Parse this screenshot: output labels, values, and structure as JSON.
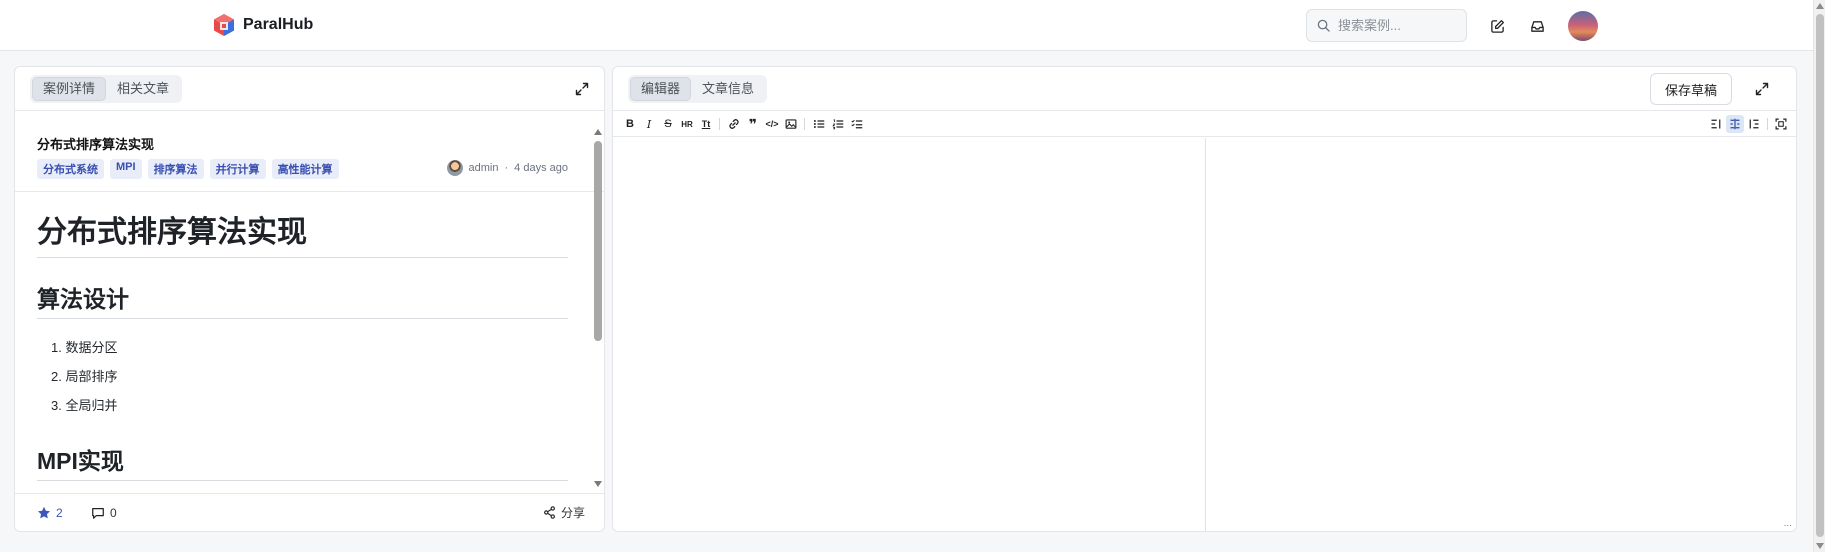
{
  "header": {
    "app_name": "ParalHub",
    "search_placeholder": "搜索案例...",
    "colors": {
      "brand_red": "#e84a4a",
      "brand_blue": "#3b6fe0"
    }
  },
  "left_panel": {
    "tabs": [
      {
        "label": "案例详情",
        "active": true
      },
      {
        "label": "相关文章",
        "active": false
      }
    ],
    "article": {
      "title": "分布式排序算法实现",
      "tags": [
        "分布式系统",
        "MPI",
        "排序算法",
        "并行计算",
        "高性能计算"
      ],
      "author": "admin",
      "separator": "·",
      "time": "4 days ago",
      "h1": "分布式排序算法实现",
      "section1": {
        "heading": "算法设计",
        "items": [
          "1. 数据分区",
          "2. 局部排序",
          "3. 全局归并"
        ]
      },
      "section2": {
        "heading": "MPI实现"
      }
    },
    "footer": {
      "stars": "2",
      "comments": "0",
      "share_label": "分享"
    }
  },
  "right_panel": {
    "tabs": [
      {
        "label": "编辑器",
        "active": true
      },
      {
        "label": "文章信息",
        "active": false
      }
    ],
    "save_label": "保存草稿",
    "toolbar": {
      "bold": "B",
      "italic": "I",
      "strike": "S",
      "hr": "HR",
      "title": "Tt",
      "quote": "❞",
      "code": "</>"
    },
    "resize_hint": "..."
  }
}
